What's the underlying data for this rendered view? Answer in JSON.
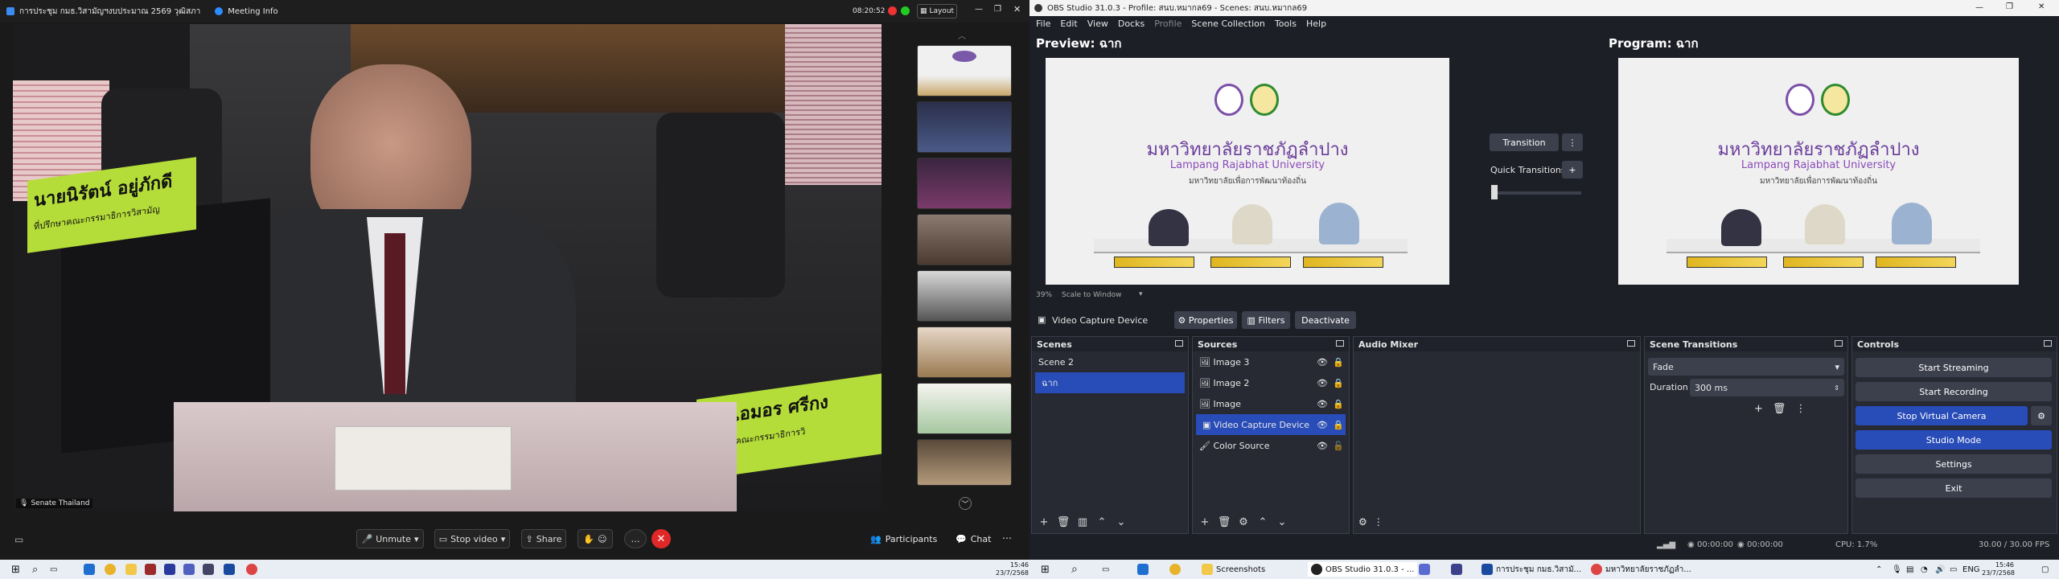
{
  "zoom": {
    "meeting_title": "การประชุม กมธ.วิสามัญฯงบประมาณ 2569 วุฒิสภา",
    "meeting_info": "Meeting Info",
    "time": "08:20:52",
    "layout": "Layout",
    "name_tag": "Senate Thailand",
    "plate_left_name": "นายนิรัตน์ อยู่ภักดี",
    "plate_left_role": "ที่ปรึกษาคณะกรรมาธิการวิสามัญ",
    "plate_right_name": "นางเอมอร ศรีกง",
    "plate_right_role": "ที่ปรึกษาคณะกรรมาธิการวิ",
    "toolbar": {
      "unmute": "Unmute",
      "stop_video": "Stop video",
      "share": "Share",
      "participants": "Participants",
      "chat": "Chat"
    }
  },
  "obs": {
    "title": "OBS Studio 31.0.3 - Profile: สนบ.หมากล69 - Scenes: สนบ.หมากล69",
    "menu": [
      "File",
      "Edit",
      "View",
      "Docks",
      "Profile",
      "Scene Collection",
      "Tools",
      "Help"
    ],
    "preview_label": "Preview: ฉาก",
    "program_label": "Program: ฉาก",
    "zoom_pct": "39%",
    "scale_mode": "Scale to Window",
    "university_th": "มหาวิทยาลัยราชภัฏลำปาง",
    "university_en": "Lampang Rajabhat University",
    "university_slogan": "มหาวิทยาลัยเพื่อการพัฒนาท้องถิ่น",
    "transition_btn": "Transition",
    "quick_transitions": "Quick Transitions",
    "source_bar": {
      "name": "Video Capture Device",
      "properties": "Properties",
      "filters": "Filters",
      "deactivate": "Deactivate"
    },
    "scenes": {
      "title": "Scenes",
      "items": [
        "Scene 2",
        "ฉาก"
      ]
    },
    "sources": {
      "title": "Sources",
      "items": [
        "Image 3",
        "Image 2",
        "Image",
        "Video Capture Device",
        "Color Source"
      ]
    },
    "audio_mixer": {
      "title": "Audio Mixer"
    },
    "scene_transitions": {
      "title": "Scene Transitions",
      "type": "Fade",
      "duration_label": "Duration",
      "duration_value": "300 ms"
    },
    "controls": {
      "title": "Controls",
      "start_streaming": "Start Streaming",
      "start_recording": "Start Recording",
      "stop_virtual_camera": "Stop Virtual Camera",
      "studio_mode": "Studio Mode",
      "settings": "Settings",
      "exit": "Exit"
    },
    "status": {
      "stream_time": "00:00:00",
      "rec_time": "00:00:00",
      "cpu": "CPU: 1.7%",
      "fps": "30.00 / 30.00 FPS"
    }
  },
  "taskbar": {
    "left_time": "15:46",
    "left_date": "23/7/2568",
    "apps": [
      "Screenshots",
      "OBS Studio 31.0.3 - ...",
      "การประชุม กมธ.วิสามั...",
      "มหาวิทยาลัยราชภัฏลำ..."
    ],
    "lang": "ENG",
    "time": "15:46",
    "date": "23/7/2568"
  },
  "colors": {
    "obs_bg": "#1d1f26",
    "obs_accent": "#284cb8",
    "zoom_bg": "#1a1a1a",
    "unmute_red": "#e02828"
  }
}
